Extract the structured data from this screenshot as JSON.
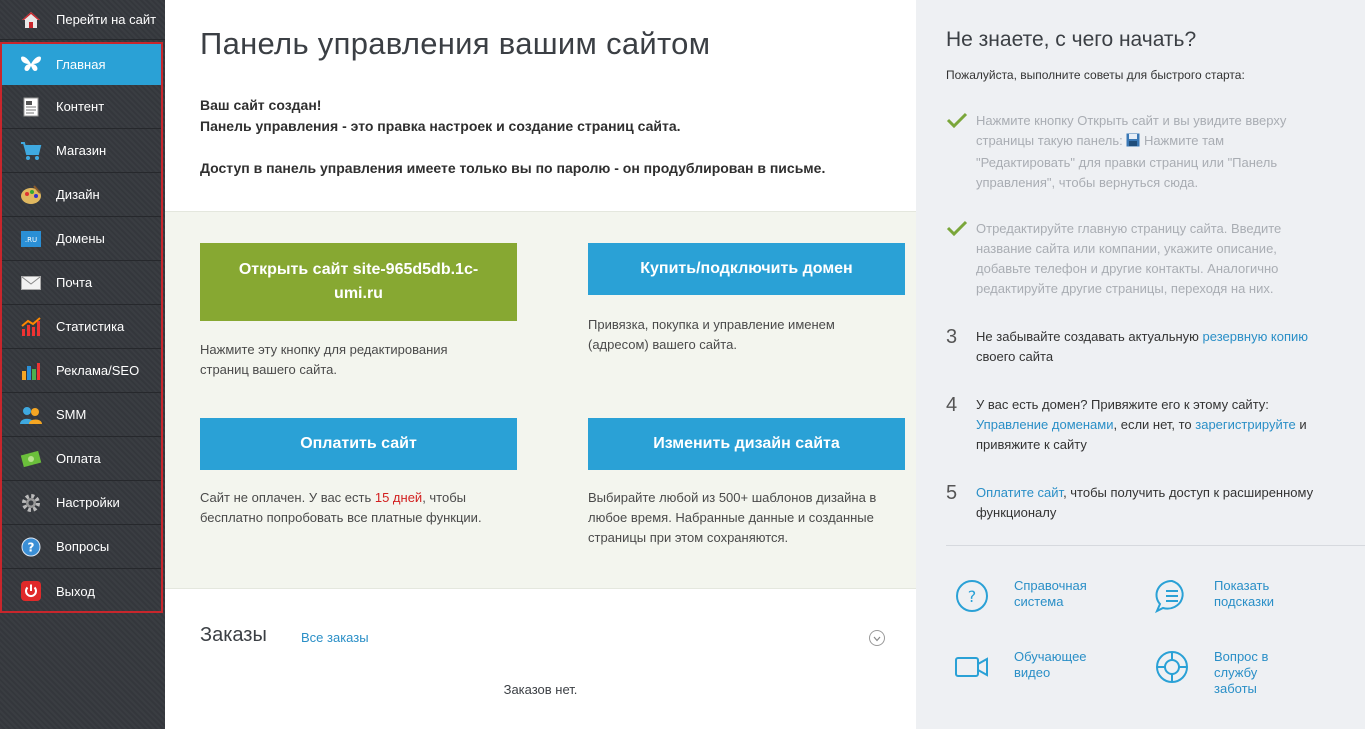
{
  "sidebar": {
    "top_link": "Перейти на сайт",
    "items": [
      {
        "label": "Главная",
        "icon": "butterfly-icon"
      },
      {
        "label": "Контент",
        "icon": "document-icon"
      },
      {
        "label": "Магазин",
        "icon": "cart-icon"
      },
      {
        "label": "Дизайн",
        "icon": "palette-icon"
      },
      {
        "label": "Домены",
        "icon": "ru-domain-icon"
      },
      {
        "label": "Почта",
        "icon": "mail-icon"
      },
      {
        "label": "Статистика",
        "icon": "stats-icon"
      },
      {
        "label": "Реклама/SEO",
        "icon": "bar-chart-icon"
      },
      {
        "label": "SMM",
        "icon": "people-icon"
      },
      {
        "label": "Оплата",
        "icon": "money-icon"
      },
      {
        "label": "Настройки",
        "icon": "gear-icon"
      },
      {
        "label": "Вопросы",
        "icon": "question-icon"
      },
      {
        "label": "Выход",
        "icon": "power-icon"
      }
    ]
  },
  "main": {
    "title": "Панель управления вашим сайтом",
    "intro_line1": "Ваш сайт создан!",
    "intro_line2": "Панель управления - это правка настроек и создание страниц сайта.",
    "intro_line3": "Доступ в панель управления имеете только вы по паролю - он продублирован в письме.",
    "open_site_button": "Открыть сайт site-965d5db.1c-umi.ru",
    "open_site_desc": "Нажмите эту кнопку для редактирования страниц вашего сайта.",
    "domain_button": "Купить/подключить домен",
    "domain_desc": "Привязка, покупка и управление именем (адресом) вашего сайта.",
    "pay_button": "Оплатить сайт",
    "pay_desc_before": "Сайт не оплачен. У вас есть ",
    "pay_desc_days": "15 дней",
    "pay_desc_after": ", чтобы бесплатно попробовать все платные функции.",
    "design_button": "Изменить дизайн сайта",
    "design_desc": "Выбирайте любой из 500+ шаблонов дизайна в любое время. Набранные данные и созданные страницы при этом сохраняются.",
    "orders_title": "Заказы",
    "orders_link": "Все заказы",
    "orders_empty": "Заказов нет."
  },
  "right": {
    "title": "Не знаете, с чего начать?",
    "subtitle": "Пожалуйста, выполните советы для быстрого старта:",
    "tip1_a": "Нажмите кнопку Открыть сайт и вы увидите вверху страницы такую панель: ",
    "tip1_b": " Нажмите там \"Редактировать\" для правки страниц или \"Панель управления\", чтобы вернуться сюда.",
    "tip2": "Отредактируйте главную страницу сайта. Введите название сайта или компании, укажите описание, добавьте телефон и другие контакты. Аналогично редактируйте другие страницы, переходя на них.",
    "tip3_num": "3",
    "tip3_a": "Не забывайте создавать актуальную ",
    "tip3_link": "резервную копию",
    "tip3_b": " своего сайта",
    "tip4_num": "4",
    "tip4_a": "У вас есть домен? Привяжите его к этому сайту: ",
    "tip4_link1": "Управление доменами",
    "tip4_b": ", если нет, то ",
    "tip4_link2": "зарегистрируйте",
    "tip4_c": " и привяжите к сайту",
    "tip5_num": "5",
    "tip5_link": "Оплатите сайт",
    "tip5_a": ", чтобы получить доступ к расширенному функционалу",
    "help1_l1": "Справочная",
    "help1_l2": "система",
    "help2_l1": "Показать",
    "help2_l2": "подсказки",
    "help3_l1": "Обучающее",
    "help3_l2": "видео",
    "help4_l1": "Вопрос в",
    "help4_l2": "службу",
    "help4_l3": "заботы"
  },
  "colors": {
    "accent_blue": "#2aa1d6",
    "green_button": "#87a832",
    "highlight_red": "#c8262c",
    "link": "#2a8fc7"
  }
}
